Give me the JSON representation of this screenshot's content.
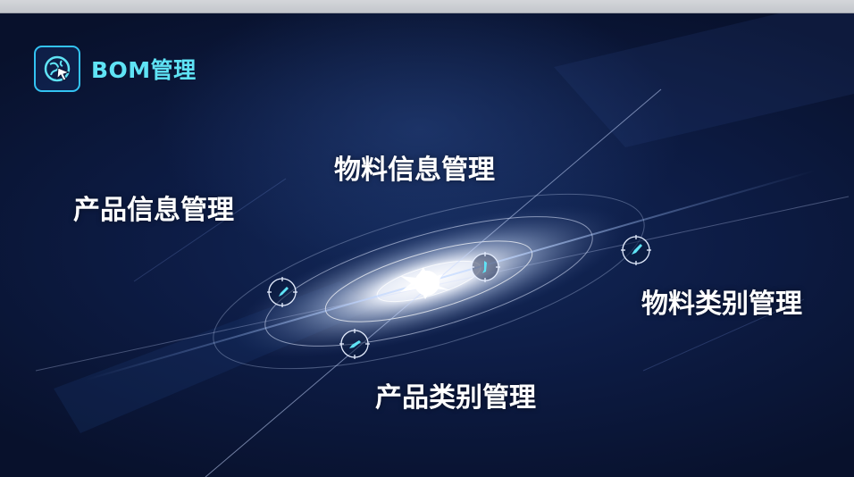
{
  "header": {
    "title": "BOM管理",
    "icon": "globe-cursor-icon"
  },
  "menu": {
    "items": [
      {
        "id": "product-info",
        "label": "产品信息管理"
      },
      {
        "id": "material-info",
        "label": "物料信息管理"
      },
      {
        "id": "material-category",
        "label": "物料类别管理"
      },
      {
        "id": "product-category",
        "label": "产品类别管理"
      }
    ]
  },
  "orbit": {
    "node_icon": "rocket-icon",
    "center_icon": "galaxy-star-icon"
  },
  "colors": {
    "accent": "#5fe3f5",
    "icon_border": "#33c3f2",
    "background": "#0b1533",
    "label": "#ffffff"
  }
}
